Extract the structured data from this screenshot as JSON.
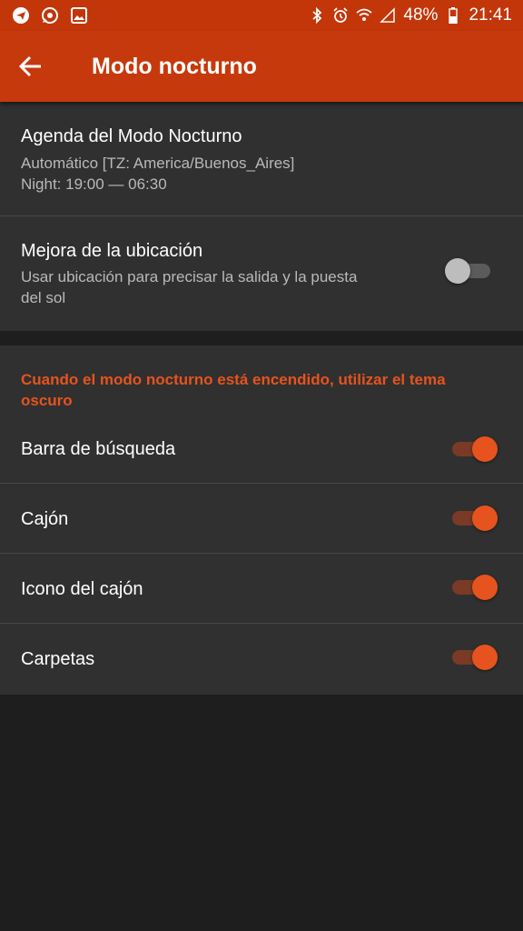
{
  "status_bar": {
    "icons_left": [
      "telegram-icon",
      "whatsapp-icon",
      "gallery-icon"
    ],
    "battery_percent": "48%",
    "time": "21:41"
  },
  "app_bar": {
    "title": "Modo nocturno"
  },
  "schedule": {
    "title": "Agenda del Modo Nocturno",
    "line1": "Automático [TZ: America/Buenos_Aires]",
    "line2": "Night: 19:00 — 06:30"
  },
  "location": {
    "title": "Mejora de la ubicación",
    "line1": "Usar ubicación para precisar la salida y la puesta",
    "line2": "del sol",
    "enabled": false
  },
  "dark_theme": {
    "header_line1": "Cuando el modo nocturno está encendido, utilizar el tema",
    "header_line2": "oscuro",
    "items": [
      {
        "label": "Barra de búsqueda",
        "enabled": true
      },
      {
        "label": "Cajón",
        "enabled": true
      },
      {
        "label": "Icono del cajón",
        "enabled": true
      },
      {
        "label": "Carpetas",
        "enabled": true
      }
    ]
  },
  "colors": {
    "accent": "#e6531e",
    "app_bar": "#c6390c",
    "status_bar": "#c3360a",
    "card": "#303030",
    "background": "#1e1e1e"
  }
}
